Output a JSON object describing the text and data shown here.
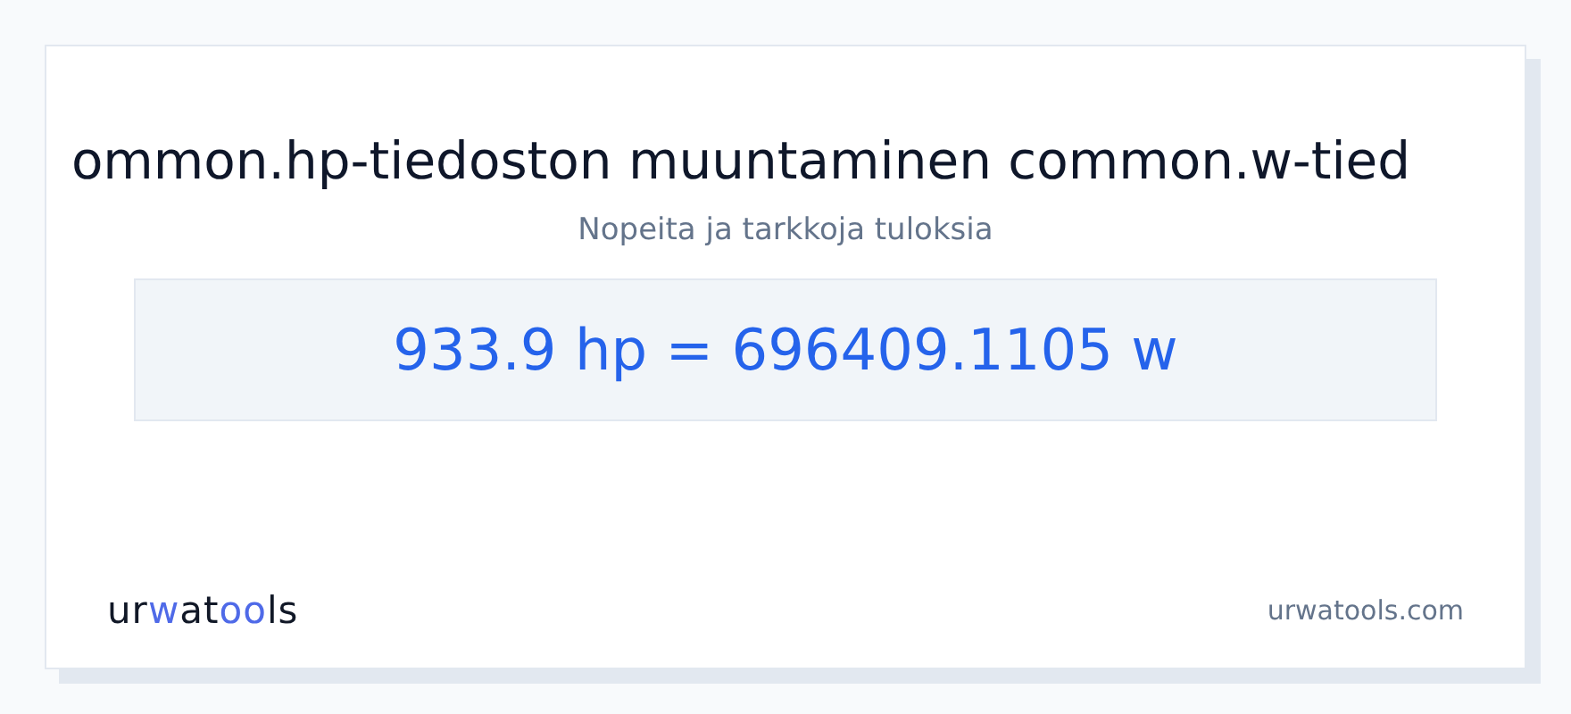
{
  "card": {
    "title": "ommon.hp-tiedoston muuntaminen common.w-tied",
    "subtitle": "Nopeita ja tarkkoja tuloksia",
    "result": "933.9 hp = 696409.1105 w"
  },
  "footer": {
    "logo": [
      {
        "text": "ur",
        "accent": false
      },
      {
        "text": "w",
        "accent": true
      },
      {
        "text": "at",
        "accent": false
      },
      {
        "text": "oo",
        "accent": true
      },
      {
        "text": "ls",
        "accent": false
      }
    ],
    "site": "urwatools.com"
  }
}
